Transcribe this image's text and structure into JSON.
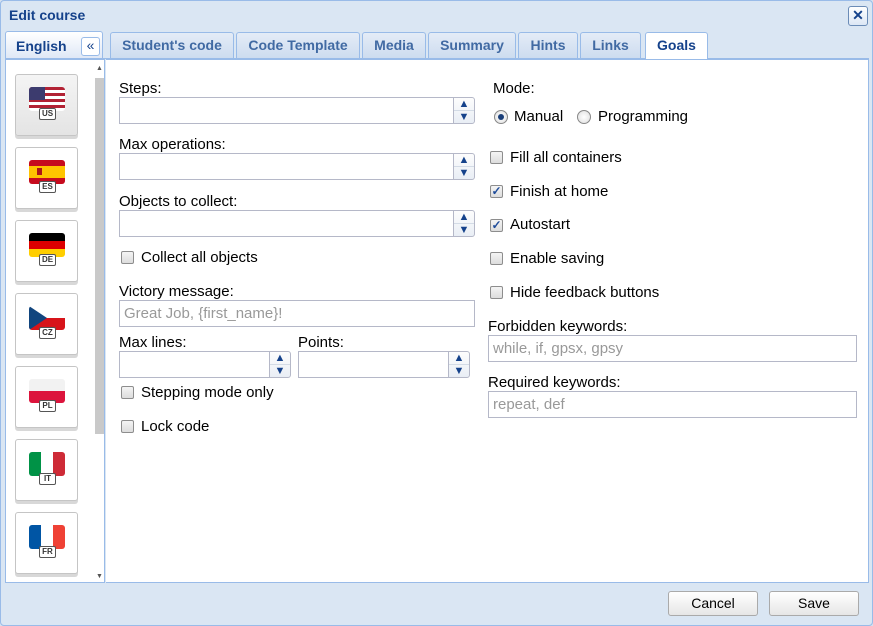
{
  "window": {
    "title": "Edit course",
    "close_icon": "close-icon"
  },
  "language_panel": {
    "title": "English",
    "collapse_icon": "double-chevron-left-icon",
    "flags": [
      {
        "code": "US",
        "colors": [
          "#b22234",
          "#ffffff",
          "#3c3b6e"
        ]
      },
      {
        "code": "ES",
        "colors": [
          "#c60b1e",
          "#ffc400",
          "#c60b1e"
        ]
      },
      {
        "code": "DE",
        "colors": [
          "#000000",
          "#dd0000",
          "#ffce00"
        ]
      },
      {
        "code": "CZ",
        "colors": [
          "#ffffff",
          "#d7141a",
          "#11457e"
        ]
      },
      {
        "code": "PL",
        "colors": [
          "#ffffff",
          "#dc143c"
        ]
      },
      {
        "code": "IT",
        "colors": [
          "#009246",
          "#ffffff",
          "#ce2b37"
        ]
      },
      {
        "code": "FR",
        "colors": [
          "#0055a4",
          "#ffffff",
          "#ef4135"
        ]
      }
    ]
  },
  "tabs": [
    "Student's code",
    "Code Template",
    "Media",
    "Summary",
    "Hints",
    "Links",
    "Goals"
  ],
  "active_tab": "Goals",
  "left_form": {
    "steps_label": "Steps:",
    "steps_value": "",
    "max_operations_label": "Max operations:",
    "max_operations_value": "",
    "objects_to_collect_label": "Objects to collect:",
    "objects_to_collect_value": "",
    "collect_all_objects_label": "Collect all objects",
    "collect_all_objects_checked": false,
    "victory_message_label": "Victory message:",
    "victory_message_placeholder": "Great Job, {first_name}!",
    "max_lines_label": "Max lines:",
    "max_lines_value": "",
    "points_label": "Points:",
    "points_value": "",
    "stepping_mode_label": "Stepping mode only",
    "stepping_mode_checked": false,
    "lock_code_label": "Lock code",
    "lock_code_checked": false
  },
  "right_form": {
    "mode_label": "Mode:",
    "mode_options": [
      "Manual",
      "Programming"
    ],
    "mode_selected": "Manual",
    "checkboxes": [
      {
        "label": "Fill all containers",
        "checked": false
      },
      {
        "label": "Finish at home",
        "checked": true
      },
      {
        "label": "Autostart",
        "checked": true
      },
      {
        "label": "Enable saving",
        "checked": false
      },
      {
        "label": "Hide feedback buttons",
        "checked": false
      }
    ],
    "forbidden_keywords_label": "Forbidden keywords:",
    "forbidden_keywords_placeholder": "while, if, gpsx, gpsy",
    "required_keywords_label": "Required keywords:",
    "required_keywords_placeholder": "repeat, def"
  },
  "footer": {
    "cancel_label": "Cancel",
    "save_label": "Save"
  }
}
